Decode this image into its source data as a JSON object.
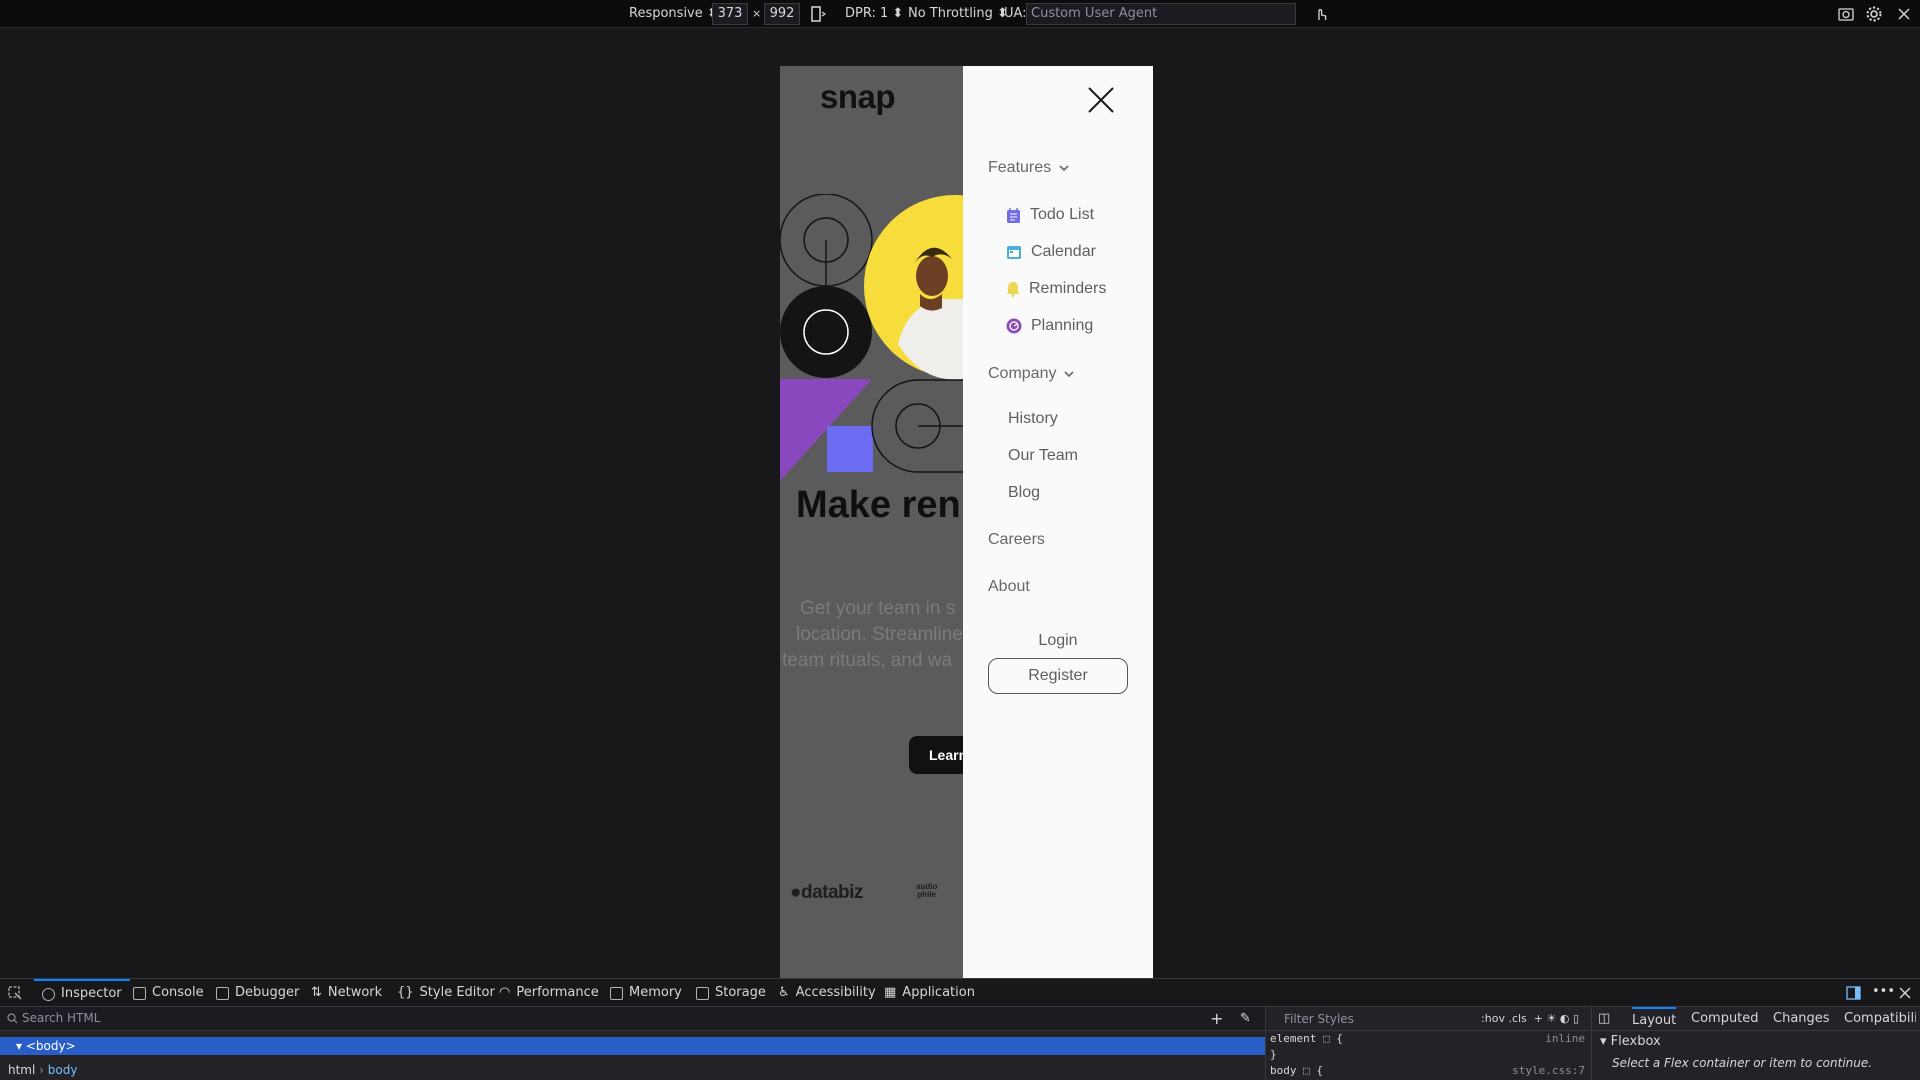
{
  "rdm": {
    "device": "Responsive",
    "width": "373",
    "times": "×",
    "height": "992",
    "dpr": "DPR: 1",
    "throttling": "No Throttling",
    "ua_label": "UA:",
    "ua_placeholder": "Custom User Agent"
  },
  "page": {
    "logo": "snap",
    "headline": "Make ren",
    "hero_lines": [
      "Get your team in s",
      "location. Streamline",
      "team rituals, and wa"
    ],
    "cta": "Learn",
    "clients": {
      "databiz": "●databiz",
      "audiophile_top": "audio",
      "audiophile_bottom": "phile"
    },
    "colors": {
      "yellow": "#f6dd3b",
      "purple": "#8a48be",
      "blue": "#6c6cf2",
      "dark": "#141414"
    }
  },
  "menu": {
    "features": {
      "label": "Features",
      "items": [
        {
          "label": "Todo List",
          "icon": "todo-list-icon",
          "color": "#726ce7"
        },
        {
          "label": "Calendar",
          "icon": "calendar-icon",
          "color": "#4bb1da"
        },
        {
          "label": "Reminders",
          "icon": "bell-icon",
          "color": "#edd556"
        },
        {
          "label": "Planning",
          "icon": "planning-icon",
          "color": "#8e4cb6"
        }
      ]
    },
    "company": {
      "label": "Company",
      "items": [
        "History",
        "Our Team",
        "Blog"
      ]
    },
    "careers": "Careers",
    "about": "About",
    "login": "Login",
    "register": "Register"
  },
  "devtools": {
    "tabs": [
      "Inspector",
      "Console",
      "Debugger",
      "Network",
      "Style Editor",
      "Performance",
      "Memory",
      "Storage",
      "Accessibility",
      "Application"
    ],
    "search_placeholder": "Search HTML",
    "selected_node": "<body>",
    "breadcrumb": [
      "html",
      "body"
    ],
    "filter_placeholder": "Filter Styles",
    "pseudo_buttons": ":hov  .cls",
    "rule_element": "element ⬚ {",
    "rule_element_source": "inline",
    "rule_close": "}",
    "rule_body": "body ⬚ {",
    "rule_body_source": "style.css:7",
    "layout_tabs": [
      "Layout",
      "Computed",
      "Changes",
      "Compatibili"
    ],
    "flexbox_title": "Flexbox",
    "flexbox_message": "Select a Flex container or item to continue."
  }
}
